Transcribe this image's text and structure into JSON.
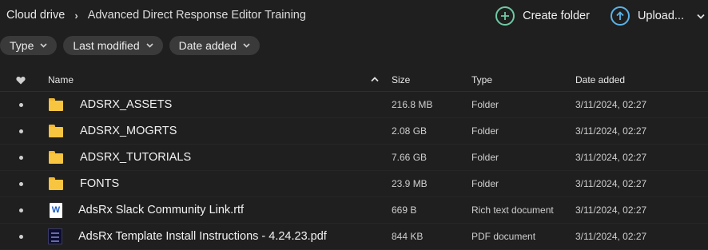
{
  "breadcrumb": {
    "root": "Cloud drive",
    "separator": "›",
    "current": "Advanced Direct Response Editor Training"
  },
  "toolbar": {
    "create_folder_label": "Create folder",
    "upload_label": "Upload..."
  },
  "filters": [
    {
      "label": "Type"
    },
    {
      "label": "Last modified"
    },
    {
      "label": "Date added"
    }
  ],
  "table": {
    "headers": {
      "name": "Name",
      "size": "Size",
      "type": "Type",
      "date_added": "Date added"
    },
    "sort": "name ascending",
    "rows": [
      {
        "name": "ADSRX_ASSETS",
        "size": "216.8 MB",
        "type": "Folder",
        "date_added": "3/11/2024, 02:27",
        "icon": "folder-icon"
      },
      {
        "name": "ADSRX_MOGRTS",
        "size": "2.08 GB",
        "type": "Folder",
        "date_added": "3/11/2024, 02:27",
        "icon": "folder-icon"
      },
      {
        "name": "ADSRX_TUTORIALS",
        "size": "7.66 GB",
        "type": "Folder",
        "date_added": "3/11/2024, 02:27",
        "icon": "folder-icon"
      },
      {
        "name": "FONTS",
        "size": "23.9 MB",
        "type": "Folder",
        "date_added": "3/11/2024, 02:27",
        "icon": "folder-icon"
      },
      {
        "name": "AdsRx Slack Community Link.rtf",
        "size": "669 B",
        "type": "Rich text document",
        "date_added": "3/11/2024, 02:27",
        "icon": "word-document-icon",
        "icon_letter": "W"
      },
      {
        "name": "AdsRx Template Install Instructions - 4.24.23.pdf",
        "size": "844 KB",
        "type": "PDF document",
        "date_added": "3/11/2024, 02:27",
        "icon": "pdf-thumbnail-icon"
      }
    ]
  },
  "colors": {
    "background": "#1f1f1f",
    "chip": "#3a3a3a",
    "create_folder_accent": "#6fc9a3",
    "upload_accent": "#5ab3e8",
    "folder": "#f8c540"
  }
}
